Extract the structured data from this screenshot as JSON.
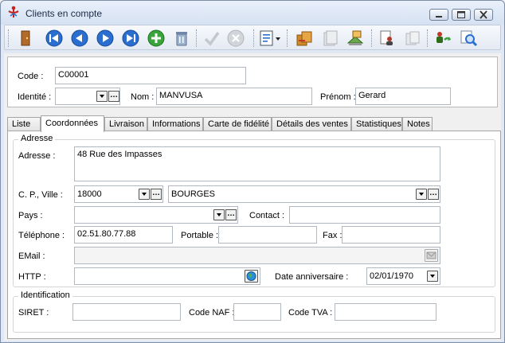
{
  "window": {
    "title": "Clients en compte",
    "accent_color": "#2a6fd0"
  },
  "toolbar": {
    "buttons": [
      {
        "name": "exit-icon"
      },
      {
        "name": "first-record-icon"
      },
      {
        "name": "previous-record-icon"
      },
      {
        "name": "next-record-icon"
      },
      {
        "name": "last-record-icon"
      },
      {
        "name": "add-record-icon"
      },
      {
        "name": "delete-record-icon"
      },
      {
        "name": "validate-icon"
      },
      {
        "name": "cancel-icon"
      },
      {
        "name": "report-menu-icon"
      },
      {
        "name": "history-icon"
      },
      {
        "name": "documents-icon"
      },
      {
        "name": "statistics-icon"
      },
      {
        "name": "users-icon"
      },
      {
        "name": "copy-icon"
      },
      {
        "name": "refresh-icon"
      },
      {
        "name": "search-icon"
      }
    ]
  },
  "header": {
    "code_label": "Code :",
    "code_value": "C00001",
    "identite_label": "Identité :",
    "identite_value": "",
    "nom_label": "Nom :",
    "nom_value": "MANVUSA",
    "prenom_label": "Prénom :",
    "prenom_value": "Gerard"
  },
  "tabs": [
    {
      "label": "Liste",
      "active": false
    },
    {
      "label": "Coordonnées",
      "active": true
    },
    {
      "label": "Livraison",
      "active": false
    },
    {
      "label": "Informations",
      "active": false
    },
    {
      "label": "Carte de fidélité",
      "active": false
    },
    {
      "label": "Détails des ventes",
      "active": false
    },
    {
      "label": "Statistiques",
      "active": false
    },
    {
      "label": "Notes",
      "active": false
    }
  ],
  "adresse_group": {
    "title": "Adresse",
    "adresse_label": "Adresse :",
    "adresse_value": "48 Rue des Impasses",
    "cp_ville_label": "C. P., Ville :",
    "cp_value": "18000",
    "ville_value": "BOURGES",
    "pays_label": "Pays :",
    "pays_value": "",
    "contact_label": "Contact :",
    "contact_value": "",
    "telephone_label": "Téléphone :",
    "telephone_value": "02.51.80.77.88",
    "portable_label": "Portable :",
    "portable_value": "",
    "fax_label": "Fax :",
    "fax_value": "",
    "email_label": "EMail :",
    "email_value": "",
    "http_label": "HTTP :",
    "http_value": "",
    "date_anniv_label": "Date anniversaire :",
    "date_anniv_value": "02/01/1970"
  },
  "identification_group": {
    "title": "Identification",
    "siret_label": "SIRET :",
    "siret_value": "",
    "code_naf_label": "Code NAF :",
    "code_naf_value": "",
    "code_tva_label": "Code TVA :",
    "code_tva_value": ""
  }
}
